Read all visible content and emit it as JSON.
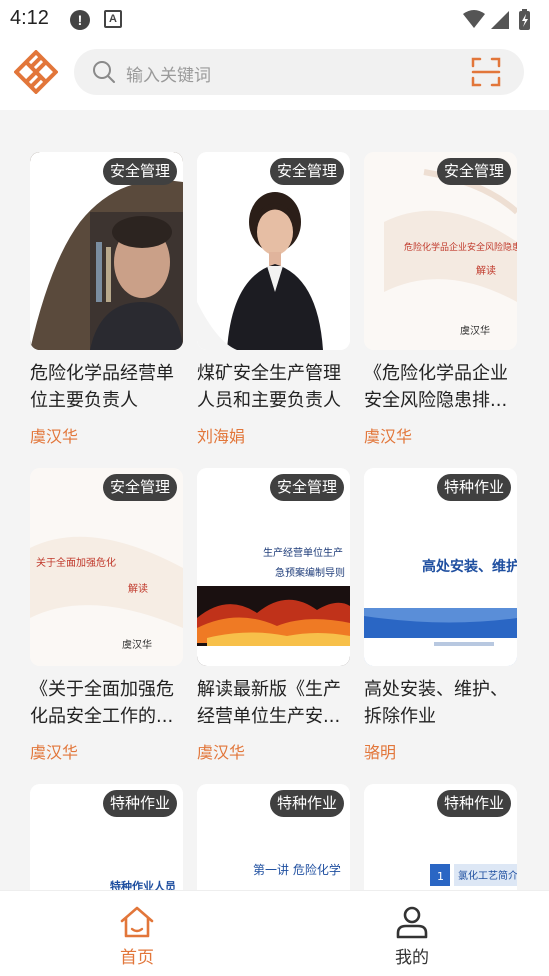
{
  "status_bar": {
    "time": "4:12",
    "alert_icon": "!",
    "a_icon": "A"
  },
  "header": {
    "search_placeholder": "输入关键词"
  },
  "courses": [
    {
      "badge": "安全管理",
      "title": "危险化学品经营单位主要负责人",
      "author": "虞汉华"
    },
    {
      "badge": "安全管理",
      "title": "煤矿安全生产管理人员和主要负责人",
      "author": "刘海娟"
    },
    {
      "badge": "安全管理",
      "title": "《危险化学品企业安全风险隐患排...",
      "author": "虞汉华",
      "thumb_lines": [
        "危险化学品企业安全风险隐患",
        "解读",
        "虞汉华"
      ]
    },
    {
      "badge": "安全管理",
      "title": "《关于全面加强危化品安全工作的...",
      "author": "虞汉华",
      "thumb_lines": [
        "关于全面加强危化",
        "解读",
        "虞汉华"
      ]
    },
    {
      "badge": "安全管理",
      "title": "解读最新版《生产经营单位生产安...",
      "author": "虞汉华",
      "thumb_lines": [
        "生产经营单位生产",
        "急预案编制导则"
      ]
    },
    {
      "badge": "特种作业",
      "title": "高处安装、维护、拆除作业",
      "author": "骆明",
      "thumb_lines": [
        "高处安装、维护、"
      ]
    },
    {
      "badge": "特种作业",
      "thumb_lines": [
        "特种作业人员"
      ]
    },
    {
      "badge": "特种作业",
      "thumb_lines": [
        "第一讲 危险化学"
      ]
    },
    {
      "badge": "特种作业",
      "thumb_lines": [
        "1",
        "氯化工艺简介"
      ]
    }
  ],
  "bottom_nav": {
    "home_label": "首页",
    "me_label": "我的"
  },
  "colors": {
    "accent": "#e2763a",
    "badge_bg": "#404040",
    "search_bg": "#f1f1f1"
  },
  "icons": {
    "search": "search-icon",
    "scan": "scan-icon",
    "home": "home-icon",
    "profile": "profile-icon",
    "wifi": "wifi-icon",
    "signal": "signal-icon",
    "battery": "battery-icon"
  }
}
